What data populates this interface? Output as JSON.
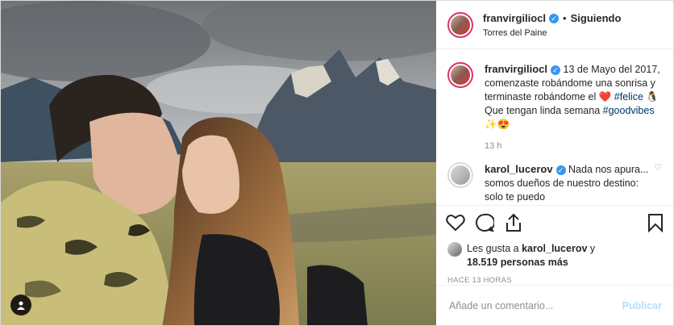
{
  "header": {
    "username": "franvirgilio",
    "username_suffix": "cl",
    "separator": "•",
    "follow_label": "Siguiendo",
    "location": "Torres del Paine"
  },
  "caption": {
    "username": "franvirgiliocl",
    "text_1": "13 de Mayo del 2017, comenzaste robándome una sonrisa y terminaste robándome el ❤️ ",
    "hashtag_1": "#felice",
    "text_2": " 🐧 Que tengan linda semana ",
    "hashtag_2": "#goodvibes",
    "text_3": " ✨😍",
    "time": "13 h"
  },
  "comment": {
    "username": "karol_lucerov",
    "text": "Nada nos apura... somos dueños de nuestro destino: solo te puedo"
  },
  "likes": {
    "prefix": "Les gusta a ",
    "user": "karol_lucerov",
    "middle": " y",
    "count_text": "18.519 personas más"
  },
  "time_ago": "HACE 13 HORAS",
  "add_comment": {
    "placeholder": "Añade un comentario...",
    "publish_label": "Publicar"
  },
  "icons": {
    "verified": "verified-badge-icon",
    "like": "heart-icon",
    "comment": "comment-bubble-icon",
    "share": "share-icon",
    "save": "bookmark-icon",
    "tag": "user-tag-icon"
  },
  "colors": {
    "verified": "#3897f0",
    "hashtag": "#003569",
    "publish_disabled": "#b2dffc"
  }
}
